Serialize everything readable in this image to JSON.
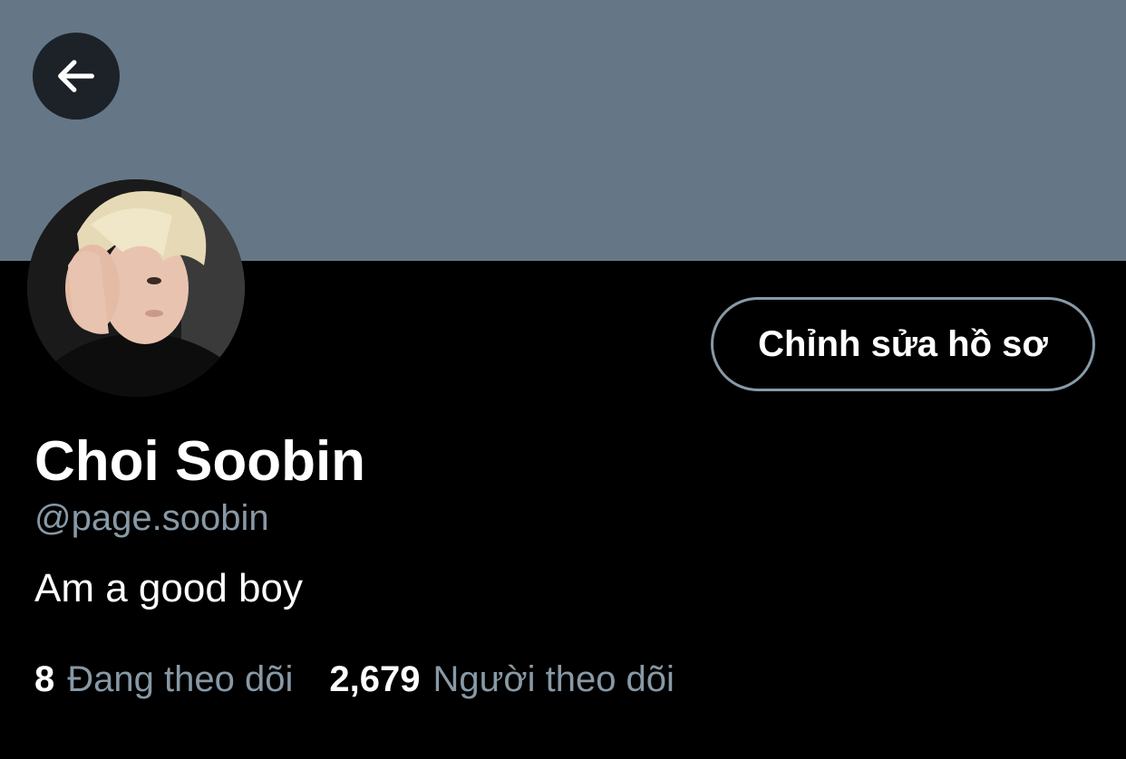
{
  "colors": {
    "banner": "#657786",
    "background": "#000000",
    "secondary_text": "#8899a6",
    "primary_text": "#ffffff"
  },
  "header": {
    "back_icon": "arrow-left-icon"
  },
  "profile": {
    "avatar_icon": "profile-photo",
    "edit_button_label": "Chỉnh sửa hồ sơ",
    "display_name": "Choi Soobin",
    "handle": "@page.soobin",
    "bio": "Am a good boy"
  },
  "stats": {
    "following_count": "8",
    "following_label": "Đang theo dõi",
    "followers_count": "2,679",
    "followers_label": "Người theo dõi"
  }
}
